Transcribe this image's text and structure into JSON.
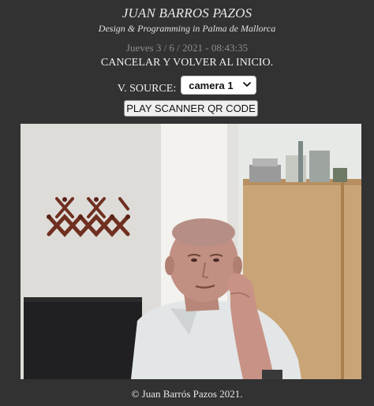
{
  "header": {
    "title": "JUAN BARROS PAZOS",
    "subtitle": "Design & Programming in Palma de Mallorca"
  },
  "datetime": "Jueves 3 / 6 / 2021 - 08:43:35",
  "cancel_link": "CANCELAR Y VOLVER AL INICIO.",
  "video_source": {
    "label": "V. SOURCE:",
    "selected": "camera 1"
  },
  "scan_button": "PLAY SCANNER QR CODE",
  "footer": "© Juan Barrós Pazos 2021."
}
